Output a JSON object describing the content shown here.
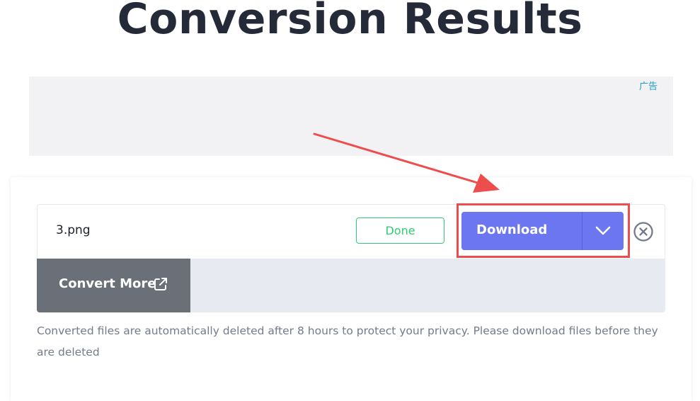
{
  "page": {
    "title": "Conversion Results"
  },
  "ad": {
    "label": "广告"
  },
  "file": {
    "name": "3.png",
    "status": "Done"
  },
  "download": {
    "label": "Download"
  },
  "actions": {
    "convert_more_label": "Convert More"
  },
  "notice": {
    "text": "Converted files are automatically deleted after 8 hours to protect your privacy. Please download files before they are deleted"
  },
  "colors": {
    "accent": "#6c76f0",
    "success": "#2ecc71",
    "highlight": "#ee4d4d",
    "title": "#252a38"
  },
  "icons": [
    "chevron-down-icon",
    "close-circle-icon",
    "external-link-icon",
    "arrow-annotation"
  ]
}
